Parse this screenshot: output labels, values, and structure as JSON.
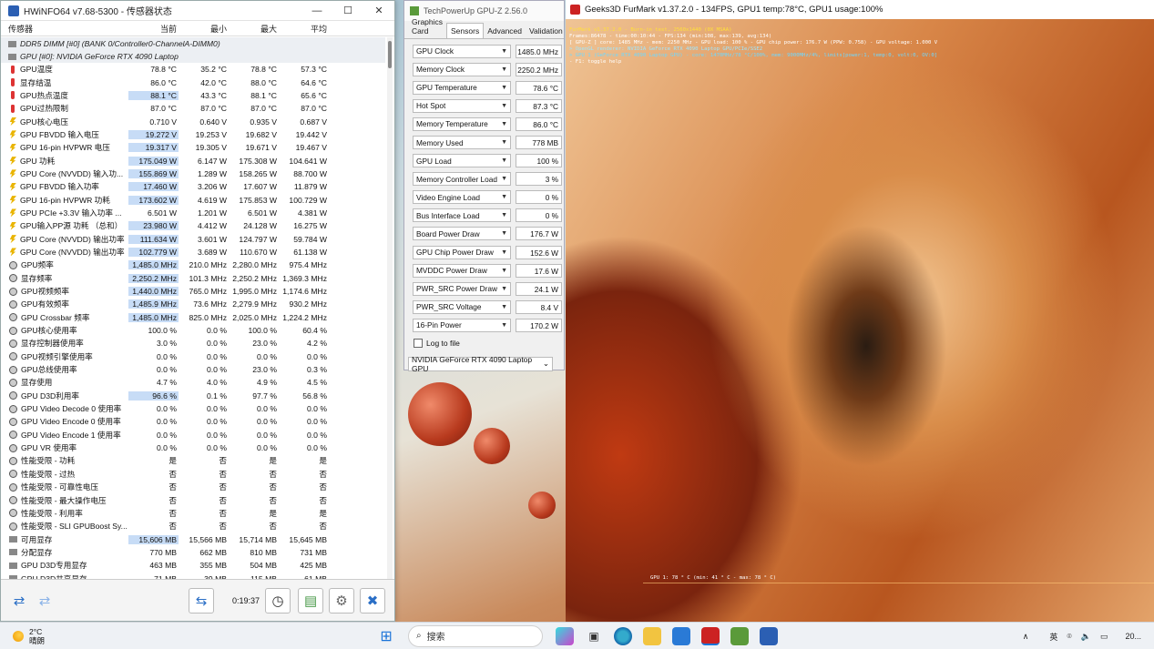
{
  "hwinfo": {
    "title": "HWiNFO64 v7.68-5300 - 传感器状态",
    "columns": [
      "传感器",
      "当前",
      "最小",
      "最大",
      "平均"
    ],
    "groups": [
      {
        "label": "DDR5 DIMM [#0] (BANK 0/Controller0-ChannelA-DIMM0)"
      },
      {
        "label": "GPU [#0]: NVIDIA GeForce RTX 4090 Laptop"
      }
    ],
    "rows": [
      {
        "icon": "thermometer",
        "name": "GPU温度",
        "cur": "78.8 °C",
        "min": "35.2 °C",
        "max": "78.8 °C",
        "avg": "57.3 °C",
        "hl": false
      },
      {
        "icon": "thermometer",
        "name": "显存结温",
        "cur": "86.0 °C",
        "min": "42.0 °C",
        "max": "88.0 °C",
        "avg": "64.6 °C",
        "hl": false
      },
      {
        "icon": "thermometer",
        "name": "GPU热点温度",
        "cur": "88.1 °C",
        "min": "43.3 °C",
        "max": "88.1 °C",
        "avg": "65.6 °C",
        "hl": true
      },
      {
        "icon": "thermometer",
        "name": "GPU过热限制",
        "cur": "87.0 °C",
        "min": "87.0 °C",
        "max": "87.0 °C",
        "avg": "87.0 °C",
        "hl": false
      },
      {
        "icon": "bolt",
        "name": "GPU核心电压",
        "cur": "0.710 V",
        "min": "0.640 V",
        "max": "0.935 V",
        "avg": "0.687 V",
        "hl": false
      },
      {
        "icon": "bolt",
        "name": "GPU FBVDD 输入电压",
        "cur": "19.272 V",
        "min": "19.253 V",
        "max": "19.682 V",
        "avg": "19.442 V",
        "hl": true
      },
      {
        "icon": "bolt",
        "name": "GPU 16-pin HVPWR 电压",
        "cur": "19.317 V",
        "min": "19.305 V",
        "max": "19.671 V",
        "avg": "19.467 V",
        "hl": true
      },
      {
        "icon": "bolt",
        "name": "GPU 功耗",
        "cur": "175.049 W",
        "min": "6.147 W",
        "max": "175.308 W",
        "avg": "104.641 W",
        "hl": true
      },
      {
        "icon": "bolt",
        "name": "GPU Core (NVVDD) 输入功...",
        "cur": "155.869 W",
        "min": "1.289 W",
        "max": "158.265 W",
        "avg": "88.700 W",
        "hl": true
      },
      {
        "icon": "bolt",
        "name": "GPU FBVDD 输入功率",
        "cur": "17.460 W",
        "min": "3.206 W",
        "max": "17.607 W",
        "avg": "11.879 W",
        "hl": true
      },
      {
        "icon": "bolt",
        "name": "GPU 16-pin HVPWR 功耗",
        "cur": "173.602 W",
        "min": "4.619 W",
        "max": "175.853 W",
        "avg": "100.729 W",
        "hl": true
      },
      {
        "icon": "bolt",
        "name": "GPU PCIe +3.3V 输入功率 ...",
        "cur": "6.501 W",
        "min": "1.201 W",
        "max": "6.501 W",
        "avg": "4.381 W",
        "hl": false
      },
      {
        "icon": "bolt",
        "name": "GPU输入PP源 功耗 （总和）",
        "cur": "23.980 W",
        "min": "4.412 W",
        "max": "24.128 W",
        "avg": "16.275 W",
        "hl": true
      },
      {
        "icon": "bolt",
        "name": "GPU Core (NVVDD) 输出功率",
        "cur": "111.634 W",
        "min": "3.601 W",
        "max": "124.797 W",
        "avg": "59.784 W",
        "hl": true
      },
      {
        "icon": "bolt",
        "name": "GPU Core (NVVDD) 输出功率",
        "cur": "102.779 W",
        "min": "3.689 W",
        "max": "110.670 W",
        "avg": "61.138 W",
        "hl": true
      },
      {
        "icon": "clock",
        "name": "GPU频率",
        "cur": "1,485.0 MHz",
        "min": "210.0 MHz",
        "max": "2,280.0 MHz",
        "avg": "975.4 MHz",
        "hl": true
      },
      {
        "icon": "clock",
        "name": "显存频率",
        "cur": "2,250.2 MHz",
        "min": "101.3 MHz",
        "max": "2,250.2 MHz",
        "avg": "1,369.3 MHz",
        "hl": true
      },
      {
        "icon": "clock",
        "name": "GPU视频频率",
        "cur": "1,440.0 MHz",
        "min": "765.0 MHz",
        "max": "1,995.0 MHz",
        "avg": "1,174.6 MHz",
        "hl": true
      },
      {
        "icon": "clock",
        "name": "GPU有效频率",
        "cur": "1,485.9 MHz",
        "min": "73.6 MHz",
        "max": "2,279.9 MHz",
        "avg": "930.2 MHz",
        "hl": true
      },
      {
        "icon": "clock",
        "name": "GPU Crossbar 频率",
        "cur": "1,485.0 MHz",
        "min": "825.0 MHz",
        "max": "2,025.0 MHz",
        "avg": "1,224.2 MHz",
        "hl": true
      },
      {
        "icon": "clock",
        "name": "GPU核心使用率",
        "cur": "100.0 %",
        "min": "0.0 %",
        "max": "100.0 %",
        "avg": "60.4 %",
        "hl": false
      },
      {
        "icon": "clock",
        "name": "显存控制器使用率",
        "cur": "3.0 %",
        "min": "0.0 %",
        "max": "23.0 %",
        "avg": "4.2 %",
        "hl": false
      },
      {
        "icon": "clock",
        "name": "GPU视频引擎使用率",
        "cur": "0.0 %",
        "min": "0.0 %",
        "max": "0.0 %",
        "avg": "0.0 %",
        "hl": false
      },
      {
        "icon": "clock",
        "name": "GPU总线使用率",
        "cur": "0.0 %",
        "min": "0.0 %",
        "max": "23.0 %",
        "avg": "0.3 %",
        "hl": false
      },
      {
        "icon": "clock",
        "name": "显存使用",
        "cur": "4.7 %",
        "min": "4.0 %",
        "max": "4.9 %",
        "avg": "4.5 %",
        "hl": false
      },
      {
        "icon": "clock",
        "name": "GPU D3D利用率",
        "cur": "96.6 %",
        "min": "0.1 %",
        "max": "97.7 %",
        "avg": "56.8 %",
        "hl": true
      },
      {
        "icon": "clock",
        "name": "GPU Video Decode 0 使用率",
        "cur": "0.0 %",
        "min": "0.0 %",
        "max": "0.0 %",
        "avg": "0.0 %",
        "hl": false
      },
      {
        "icon": "clock",
        "name": "GPU Video Encode 0 使用率",
        "cur": "0.0 %",
        "min": "0.0 %",
        "max": "0.0 %",
        "avg": "0.0 %",
        "hl": false
      },
      {
        "icon": "clock",
        "name": "GPU Video Encode 1 使用率",
        "cur": "0.0 %",
        "min": "0.0 %",
        "max": "0.0 %",
        "avg": "0.0 %",
        "hl": false
      },
      {
        "icon": "clock",
        "name": "GPU VR 使用率",
        "cur": "0.0 %",
        "min": "0.0 %",
        "max": "0.0 %",
        "avg": "0.0 %",
        "hl": false
      },
      {
        "icon": "clock",
        "name": "性能受限 - 功耗",
        "cur": "是",
        "min": "否",
        "max": "是",
        "avg": "是",
        "hl": false
      },
      {
        "icon": "clock",
        "name": "性能受限 - 过热",
        "cur": "否",
        "min": "否",
        "max": "否",
        "avg": "否",
        "hl": false
      },
      {
        "icon": "clock",
        "name": "性能受限 - 可靠性电压",
        "cur": "否",
        "min": "否",
        "max": "否",
        "avg": "否",
        "hl": false
      },
      {
        "icon": "clock",
        "name": "性能受限 - 最大操作电压",
        "cur": "否",
        "min": "否",
        "max": "否",
        "avg": "否",
        "hl": false
      },
      {
        "icon": "clock",
        "name": "性能受限 - 利用率",
        "cur": "否",
        "min": "否",
        "max": "是",
        "avg": "是",
        "hl": false
      },
      {
        "icon": "clock",
        "name": "性能受限 - SLI GPUBoost Sy...",
        "cur": "否",
        "min": "否",
        "max": "否",
        "avg": "否",
        "hl": false
      },
      {
        "icon": "chip",
        "name": "可用显存",
        "cur": "15,606 MB",
        "min": "15,566 MB",
        "max": "15,714 MB",
        "avg": "15,645 MB",
        "hl": true
      },
      {
        "icon": "chip",
        "name": "分配显存",
        "cur": "770 MB",
        "min": "662 MB",
        "max": "810 MB",
        "avg": "731 MB",
        "hl": false
      },
      {
        "icon": "chip",
        "name": "GPU D3D专用显存",
        "cur": "463 MB",
        "min": "355 MB",
        "max": "504 MB",
        "avg": "425 MB",
        "hl": false
      },
      {
        "icon": "chip",
        "name": "GPU D3D共享显存",
        "cur": "71 MB",
        "min": "39 MB",
        "max": "115 MB",
        "avg": "61 MB",
        "hl": false
      }
    ],
    "timer": "0:19:37"
  },
  "gpuz": {
    "title": "TechPowerUp GPU-Z 2.56.0",
    "tabs": [
      "Graphics Card",
      "Sensors",
      "Advanced",
      "Validation"
    ],
    "sensors": [
      {
        "label": "GPU Clock",
        "value": "1485.0 MHz"
      },
      {
        "label": "Memory Clock",
        "value": "2250.2 MHz"
      },
      {
        "label": "GPU Temperature",
        "value": "78.6 °C"
      },
      {
        "label": "Hot Spot",
        "value": "87.3 °C"
      },
      {
        "label": "Memory Temperature",
        "value": "86.0 °C"
      },
      {
        "label": "Memory Used",
        "value": "778 MB"
      },
      {
        "label": "GPU Load",
        "value": "100 %"
      },
      {
        "label": "Memory Controller Load",
        "value": "3 %"
      },
      {
        "label": "Video Engine Load",
        "value": "0 %"
      },
      {
        "label": "Bus Interface Load",
        "value": "0 %"
      },
      {
        "label": "Board Power Draw",
        "value": "176.7 W"
      },
      {
        "label": "GPU Chip Power Draw",
        "value": "152.6 W"
      },
      {
        "label": "MVDDC Power Draw",
        "value": "17.6 W"
      },
      {
        "label": "PWR_SRC Power Draw",
        "value": "24.1 W"
      },
      {
        "label": "PWR_SRC Voltage",
        "value": "8.4 V"
      },
      {
        "label": "16-Pin Power",
        "value": "170.2 W"
      }
    ],
    "log_label": "Log to file",
    "device": "NVIDIA GeForce RTX 4090 Laptop GPU"
  },
  "furmark": {
    "title": "Geeks3D FurMark v1.37.2.0 - 134FPS, GPU1 temp:78°C, GPU1 usage:100%",
    "osd": [
      {
        "text": "FurMark v1.37.2.0 - Burn-in test, 2560x1440 (0X MSAA)",
        "color": "#ffe03a"
      },
      {
        "text": "Frames:86478 - time:00:10:44 - FPS:134 (min:108, max:139, avg:134)",
        "color": "#ffffff"
      },
      {
        "text": "[ GPU-Z ] core: 1485 MHz - mem: 2250 MHz - GPU load: 100 % - GPU chip power: 176.7 W (PPW: 0.758) - GPU voltage: 1.000 V",
        "color": "#ffffff"
      },
      {
        "text": "> OpenGL renderer: NVIDIA GeForce RTX 4090 Laptop GPU/PCIe/SSE2",
        "color": "#9ee6ff"
      },
      {
        "text": "> GPU 1 (GeForce RTX 4090 Laptop GPU) - core: 1470MHz/78 °C/100%, mem: 9000MHz/4%, limits[power:1, temp:0, volt:0, OV:0]",
        "color": "#6fd8ff"
      },
      {
        "text": "- F1: toggle help",
        "color": "#ffffff"
      }
    ],
    "graph_label": "GPU 1: 78 ° C (min: 41 ° C - max: 78 ° C)"
  },
  "taskbar": {
    "weather_temp": "2°C",
    "weather_desc": "晴朗",
    "search_placeholder": "搜索",
    "ime": "英",
    "clock": "20..."
  }
}
